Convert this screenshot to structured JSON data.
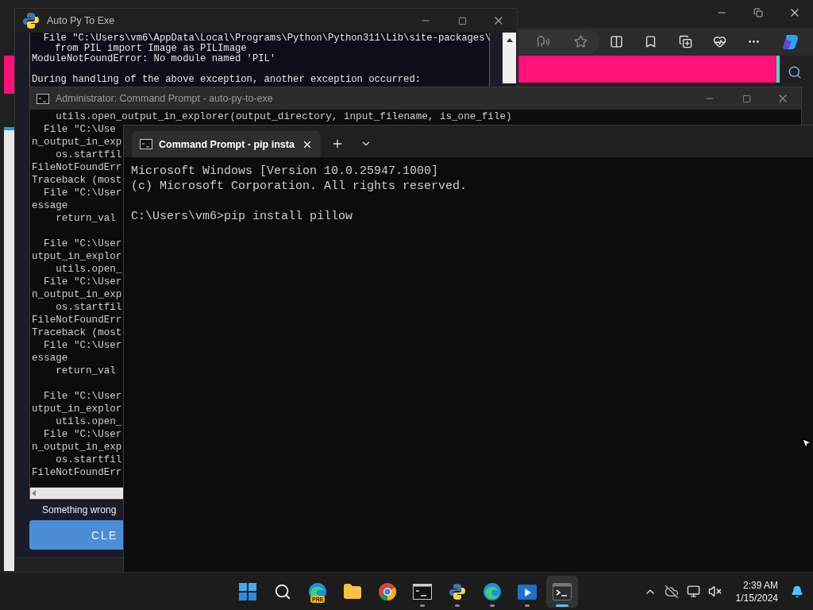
{
  "auto_py_window": {
    "title": "Auto Py To Exe",
    "console_blocks": [
      [
        "  File \"C:\\Users\\vm6\\AppData\\Local\\Programs\\Python\\Python311\\Lib\\site-packages\\",
        "    from PIL import Image as PILImage",
        "ModuleNotFoundError: No module named 'PIL'"
      ],
      [
        "During handling of the above exception, another exception occurred:"
      ]
    ],
    "status_message": "Something wrong",
    "button": "CLE"
  },
  "admin_window": {
    "title": "Administrator: Command Prompt - auto-py-to-exe",
    "blocks": [
      [
        "    utils.open_output_in_explorer(output_directory, input_filename, is_one_file)",
        "  File \"C:\\Use",
        "n_output_in_exp",
        "    os.startfil",
        "FileNotFoundErr",
        "Traceback (most",
        "  File \"C:\\User",
        "essage",
        "    return_val"
      ],
      [
        "  File \"C:\\User",
        "utput_in_explor",
        "    utils.open_",
        "  File \"C:\\User",
        "n_output_in_exp",
        "    os.startfil",
        "FileNotFoundErr",
        "Traceback (most",
        "  File \"C:\\User",
        "essage",
        "    return_val"
      ],
      [
        "  File \"C:\\User",
        "utput_in_explor",
        "    utils.open_",
        "  File \"C:\\User",
        "n_output_in_exp",
        "    os.startfil",
        "FileNotFoundErr"
      ]
    ]
  },
  "terminal": {
    "tabs": [
      {
        "title": "Command Prompt - pip  insta",
        "selected": true
      }
    ],
    "blocks": [
      [
        "Microsoft Windows [Version 10.0.25947.1000]",
        "(c) Microsoft Corporation. All rights reserved."
      ],
      [
        "C:\\Users\\vm6>pip install pillow"
      ]
    ]
  },
  "taskbar": {
    "apps": [
      {
        "kind": "start",
        "running": false,
        "selected": false
      },
      {
        "kind": "search",
        "running": false,
        "selected": false
      },
      {
        "kind": "edge-pre",
        "badge": "PRE",
        "running": false,
        "selected": false
      },
      {
        "kind": "explorer",
        "running": false,
        "selected": false
      },
      {
        "kind": "chrome",
        "running": false,
        "selected": false
      },
      {
        "kind": "cmd",
        "running": true,
        "selected": false
      },
      {
        "kind": "python",
        "running": true,
        "selected": false
      },
      {
        "kind": "edge",
        "running": true,
        "selected": false
      },
      {
        "kind": "media",
        "running": true,
        "selected": false
      },
      {
        "kind": "terminal",
        "running": true,
        "selected": true
      }
    ],
    "time": "2:39 AM",
    "date": "1/15/2024"
  }
}
